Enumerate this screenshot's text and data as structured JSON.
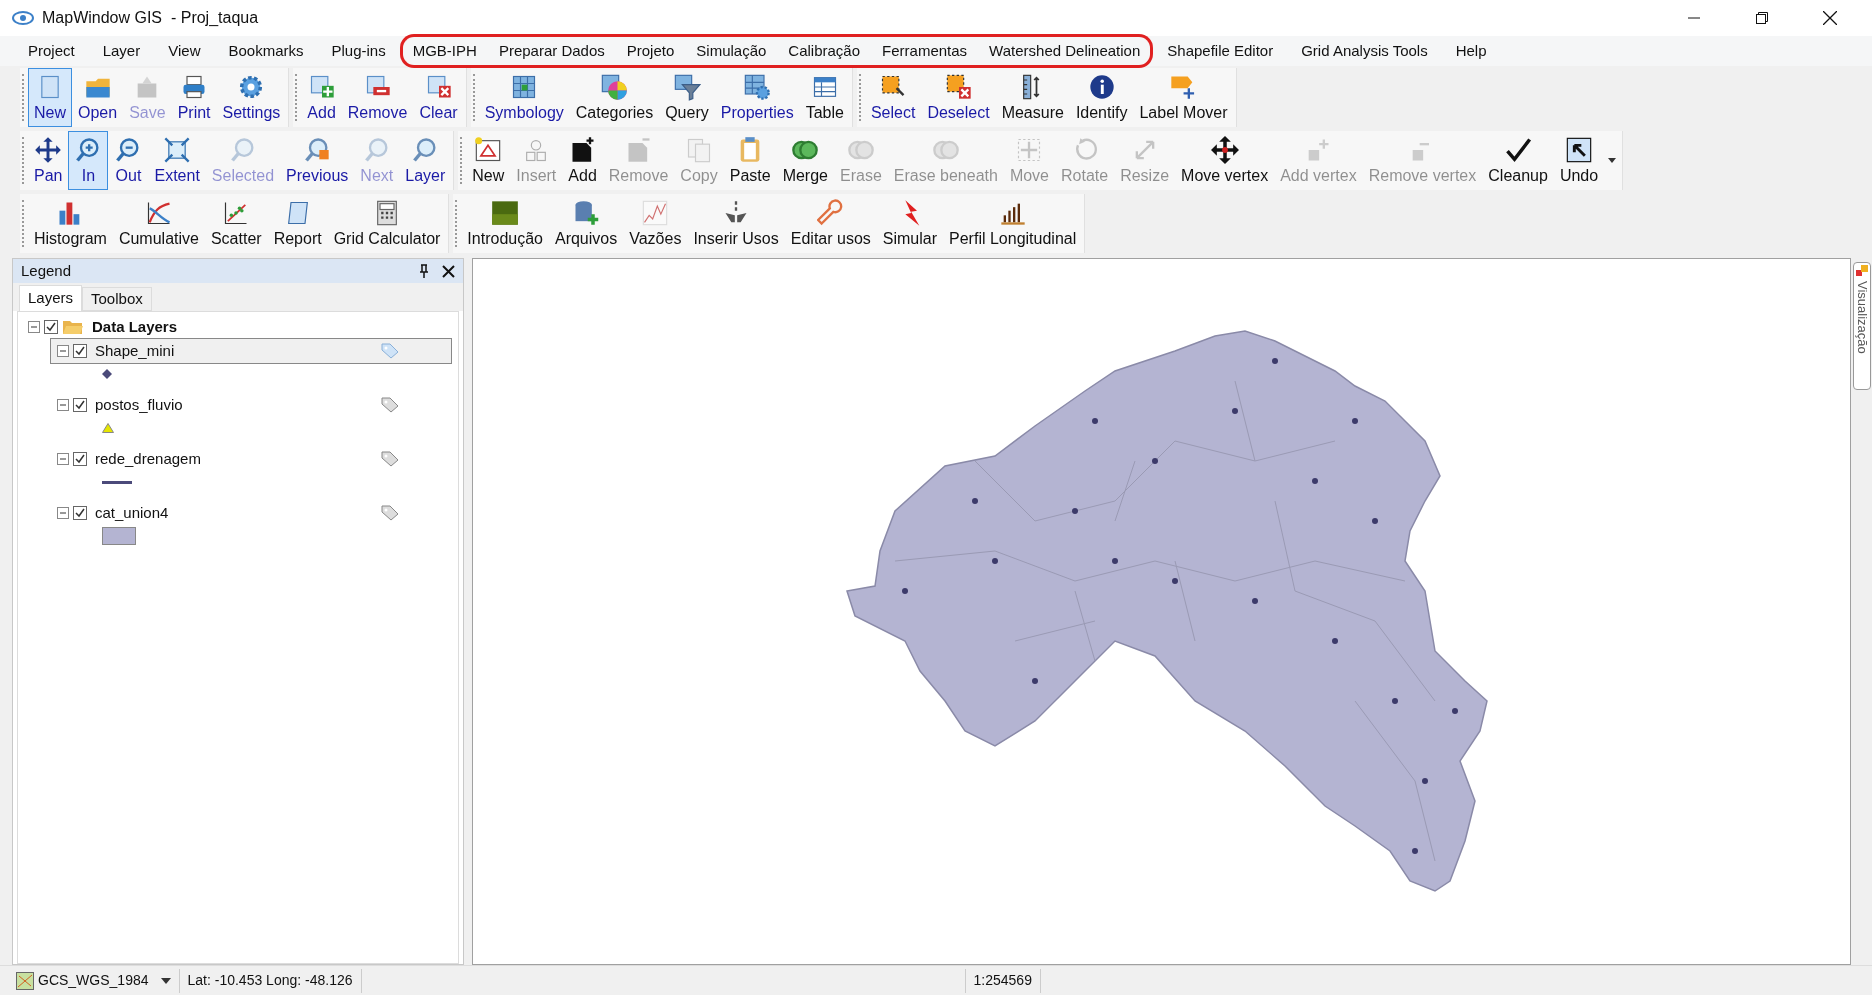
{
  "window": {
    "title": "MapWindow GIS  - Proj_taqua"
  },
  "menu": [
    {
      "label": "Project",
      "circled": false
    },
    {
      "label": "Layer",
      "circled": false
    },
    {
      "label": "View",
      "circled": false
    },
    {
      "label": "Bookmarks",
      "circled": false
    },
    {
      "label": "Plug-ins",
      "circled": false
    },
    {
      "label": "MGB-IPH",
      "circled": true
    },
    {
      "label": "Preparar Dados",
      "circled": true
    },
    {
      "label": "Projeto",
      "circled": true
    },
    {
      "label": "Simulação",
      "circled": true
    },
    {
      "label": "Calibração",
      "circled": true
    },
    {
      "label": "Ferramentas",
      "circled": true
    },
    {
      "label": "Watershed Delineation",
      "circled": true
    },
    {
      "label": "Shapefile Editor",
      "circled": false
    },
    {
      "label": "Grid Analysis Tools",
      "circled": false
    },
    {
      "label": "Help",
      "circled": false
    }
  ],
  "toolbar_rows": [
    {
      "toolbars": [
        {
          "buttons": [
            {
              "label": "New",
              "kind": "link",
              "disabled": false,
              "selected": true
            },
            {
              "label": "Open",
              "kind": "link",
              "disabled": false,
              "selected": false
            },
            {
              "label": "Save",
              "kind": "link",
              "disabled": true,
              "selected": false
            },
            {
              "label": "Print",
              "kind": "link",
              "disabled": false,
              "selected": false
            },
            {
              "label": "Settings",
              "kind": "link",
              "disabled": false,
              "selected": false
            }
          ]
        },
        {
          "buttons": [
            {
              "label": "Add",
              "kind": "link",
              "disabled": false,
              "selected": false
            },
            {
              "label": "Remove",
              "kind": "link",
              "disabled": false,
              "selected": false
            },
            {
              "label": "Clear",
              "kind": "link",
              "disabled": false,
              "selected": false
            }
          ]
        },
        {
          "buttons": [
            {
              "label": "Symbology",
              "kind": "link",
              "disabled": false,
              "selected": false
            },
            {
              "label": "Categories",
              "kind": "plain",
              "disabled": false,
              "selected": false
            },
            {
              "label": "Query",
              "kind": "plain",
              "disabled": false,
              "selected": false
            },
            {
              "label": "Properties",
              "kind": "link",
              "disabled": false,
              "selected": false
            },
            {
              "label": "Table",
              "kind": "plain",
              "disabled": false,
              "selected": false
            }
          ]
        },
        {
          "buttons": [
            {
              "label": "Select",
              "kind": "link",
              "disabled": false,
              "selected": false
            },
            {
              "label": "Deselect",
              "kind": "link",
              "disabled": false,
              "selected": false
            },
            {
              "label": "Measure",
              "kind": "plain",
              "disabled": false,
              "selected": false
            },
            {
              "label": "Identify",
              "kind": "plain",
              "disabled": false,
              "selected": false
            },
            {
              "label": "Label Mover",
              "kind": "plain",
              "disabled": false,
              "selected": false
            }
          ]
        }
      ]
    },
    {
      "toolbars": [
        {
          "buttons": [
            {
              "label": "Pan",
              "kind": "link",
              "disabled": false,
              "selected": false
            },
            {
              "label": "In",
              "kind": "link",
              "disabled": false,
              "selected": true
            },
            {
              "label": "Out",
              "kind": "link",
              "disabled": false,
              "selected": false
            },
            {
              "label": "Extent",
              "kind": "link",
              "disabled": false,
              "selected": false
            },
            {
              "label": "Selected",
              "kind": "link",
              "disabled": true,
              "selected": false
            },
            {
              "label": "Previous",
              "kind": "link",
              "disabled": false,
              "selected": false
            },
            {
              "label": "Next",
              "kind": "link",
              "disabled": true,
              "selected": false
            },
            {
              "label": "Layer",
              "kind": "link",
              "disabled": false,
              "selected": false
            }
          ]
        },
        {
          "buttons": [
            {
              "label": "New",
              "kind": "plain",
              "disabled": false,
              "selected": false
            },
            {
              "label": "Insert",
              "kind": "plain",
              "disabled": true,
              "selected": false
            },
            {
              "label": "Add",
              "kind": "plain",
              "disabled": false,
              "selected": false
            },
            {
              "label": "Remove",
              "kind": "plain",
              "disabled": true,
              "selected": false
            },
            {
              "label": "Copy",
              "kind": "plain",
              "disabled": true,
              "selected": false
            },
            {
              "label": "Paste",
              "kind": "plain",
              "disabled": false,
              "selected": false
            },
            {
              "label": "Merge",
              "kind": "plain",
              "disabled": false,
              "selected": false
            },
            {
              "label": "Erase",
              "kind": "plain",
              "disabled": true,
              "selected": false
            },
            {
              "label": "Erase beneath",
              "kind": "plain",
              "disabled": true,
              "selected": false
            },
            {
              "label": "Move",
              "kind": "plain",
              "disabled": true,
              "selected": false
            },
            {
              "label": "Rotate",
              "kind": "plain",
              "disabled": true,
              "selected": false
            },
            {
              "label": "Resize",
              "kind": "plain",
              "disabled": true,
              "selected": false
            },
            {
              "label": "Move vertex",
              "kind": "plain",
              "disabled": false,
              "selected": false
            },
            {
              "label": "Add vertex",
              "kind": "plain",
              "disabled": true,
              "selected": false
            },
            {
              "label": "Remove vertex",
              "kind": "plain",
              "disabled": true,
              "selected": false
            },
            {
              "label": "Cleanup",
              "kind": "plain",
              "disabled": false,
              "selected": false
            },
            {
              "label": "Undo",
              "kind": "plain",
              "disabled": false,
              "selected": false
            }
          ]
        }
      ]
    },
    {
      "toolbars": [
        {
          "buttons": [
            {
              "label": "Histogram",
              "kind": "plain",
              "disabled": false,
              "selected": false
            },
            {
              "label": "Cumulative",
              "kind": "plain",
              "disabled": false,
              "selected": false
            },
            {
              "label": "Scatter",
              "kind": "plain",
              "disabled": false,
              "selected": false
            },
            {
              "label": "Report",
              "kind": "plain",
              "disabled": false,
              "selected": false
            },
            {
              "label": "Grid Calculator",
              "kind": "plain",
              "disabled": false,
              "selected": false
            }
          ]
        },
        {
          "buttons": [
            {
              "label": "Introdução",
              "kind": "plain",
              "disabled": false,
              "selected": false
            },
            {
              "label": "Arquivos",
              "kind": "plain",
              "disabled": false,
              "selected": false
            },
            {
              "label": "Vazões",
              "kind": "plain",
              "disabled": false,
              "selected": false
            },
            {
              "label": "Inserir Usos",
              "kind": "plain",
              "disabled": false,
              "selected": false
            },
            {
              "label": "Editar usos",
              "kind": "plain",
              "disabled": false,
              "selected": false
            },
            {
              "label": "Simular",
              "kind": "plain",
              "disabled": false,
              "selected": false
            },
            {
              "label": "Perfil Longitudinal",
              "kind": "plain",
              "disabled": false,
              "selected": false
            }
          ]
        }
      ]
    }
  ],
  "legend": {
    "title": "Legend",
    "tabs": [
      {
        "label": "Layers",
        "selected": true
      },
      {
        "label": "Toolbox",
        "selected": false
      }
    ],
    "groups": [
      {
        "label": "Data Layers",
        "checked": true,
        "expanded": true,
        "children": [
          {
            "label": "Shape_mini",
            "checked": true,
            "expanded": true,
            "selected": true,
            "symbol": {
              "kind": "point",
              "color": "#4b4a7a"
            }
          },
          {
            "label": "postos_fluvio",
            "checked": true,
            "expanded": true,
            "selected": false,
            "symbol": {
              "kind": "triangle",
              "color": "#e6e600"
            }
          },
          {
            "label": "rede_drenagem",
            "checked": true,
            "expanded": true,
            "selected": false,
            "symbol": {
              "kind": "line",
              "color": "#4b4a7a"
            }
          },
          {
            "label": "cat_union4",
            "checked": true,
            "expanded": true,
            "selected": false,
            "symbol": {
              "kind": "polygon",
              "color": "#b4b4d2"
            }
          }
        ]
      }
    ]
  },
  "side_tab": {
    "label": "Visualização"
  },
  "status_bar": {
    "projection": "GCS_WGS_1984",
    "coordinates": "Lat: -10.453 Long: -48.126",
    "scale": "1:254569"
  }
}
